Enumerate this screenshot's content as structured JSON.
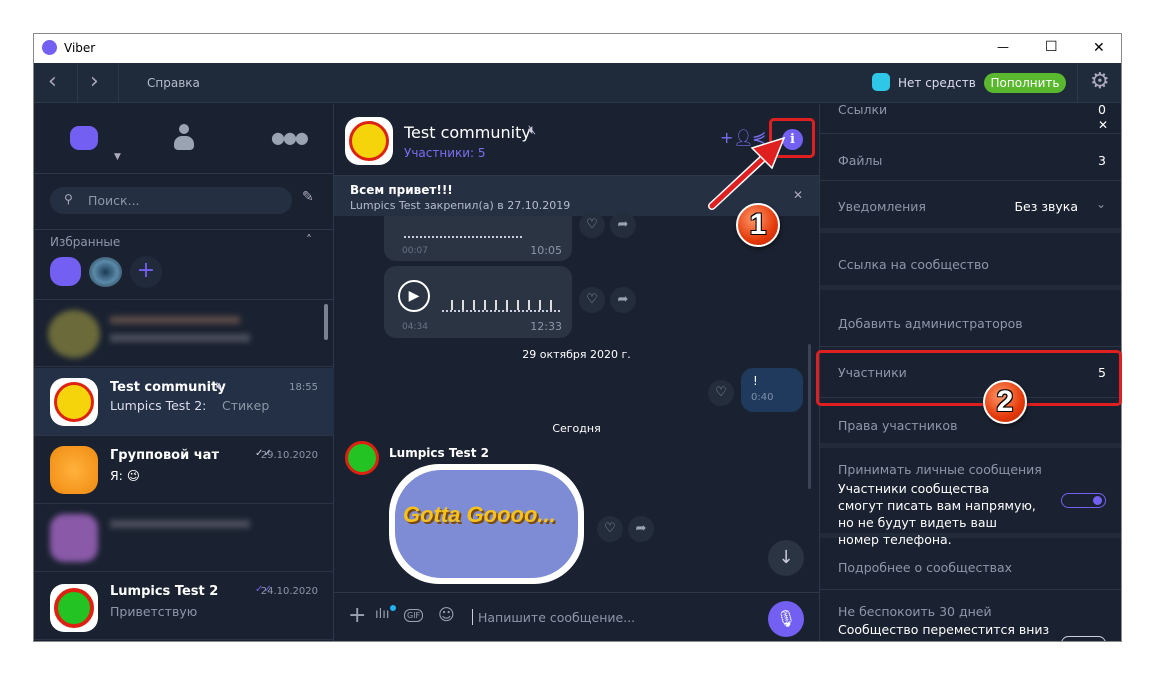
{
  "window": {
    "title": "Viber",
    "minimize": "—",
    "maximize": "☐",
    "close": "✕"
  },
  "topbar": {
    "menu_help": "Справка",
    "balance": "Нет средств",
    "topup": "Пополнить"
  },
  "sidebar": {
    "search_placeholder": "Поиск...",
    "favorites_label": "Избранные",
    "chats": [
      {
        "name": "Test community",
        "time": "18:55",
        "preview_sender": "Lumpics Test 2:",
        "preview": "Стикер"
      },
      {
        "name": "Групповой чат",
        "time": "29.10.2020",
        "preview": "Я: 😉"
      },
      {
        "name": "Lumpics Test 2",
        "time": "24.10.2020",
        "preview": "Приветствую"
      }
    ]
  },
  "chat": {
    "title": "Test community",
    "subtitle": "Участники: 5",
    "pinned": {
      "text": "Всем привет!!!",
      "meta": "Lumpics Test закрепил(а) в 27.10.2019"
    },
    "voice1": {
      "duration": "00:07",
      "time": "10:05"
    },
    "voice2": {
      "duration": "04:34",
      "time": "12:33"
    },
    "date1": "29 октября 2020 г.",
    "out_msg": {
      "text": "!",
      "time": "0:40"
    },
    "date2": "Сегодня",
    "sender": "Lumpics Test 2",
    "sticker_text": "Gotta Goooo...",
    "input_placeholder": "Напишите сообщение..."
  },
  "info_panel": {
    "links": {
      "label": "Ссылки",
      "value": "0"
    },
    "files": {
      "label": "Файлы",
      "value": "3"
    },
    "notifications": {
      "label": "Уведомления",
      "value": "Без звука"
    },
    "community_link": "Ссылка на сообщество",
    "add_admins": "Добавить администраторов",
    "members": {
      "label": "Участники",
      "value": "5"
    },
    "member_rights": "Права участников",
    "private_msgs": {
      "label": "Принимать личные сообщения",
      "desc": "Участники сообщества смогут писать вам напрямую, но не будут видеть ваш номер телефона.",
      "enabled": true
    },
    "about": "Подробнее о сообществах",
    "dnd": {
      "label": "Не беспокоить 30 дней",
      "desc": "Сообщество переместится вниз",
      "enabled": false
    }
  },
  "annotations": {
    "step1": "1",
    "step2": "2"
  },
  "colors": {
    "accent": "#7360f2",
    "topup": "#59b82d",
    "annotation": "#e02020"
  }
}
